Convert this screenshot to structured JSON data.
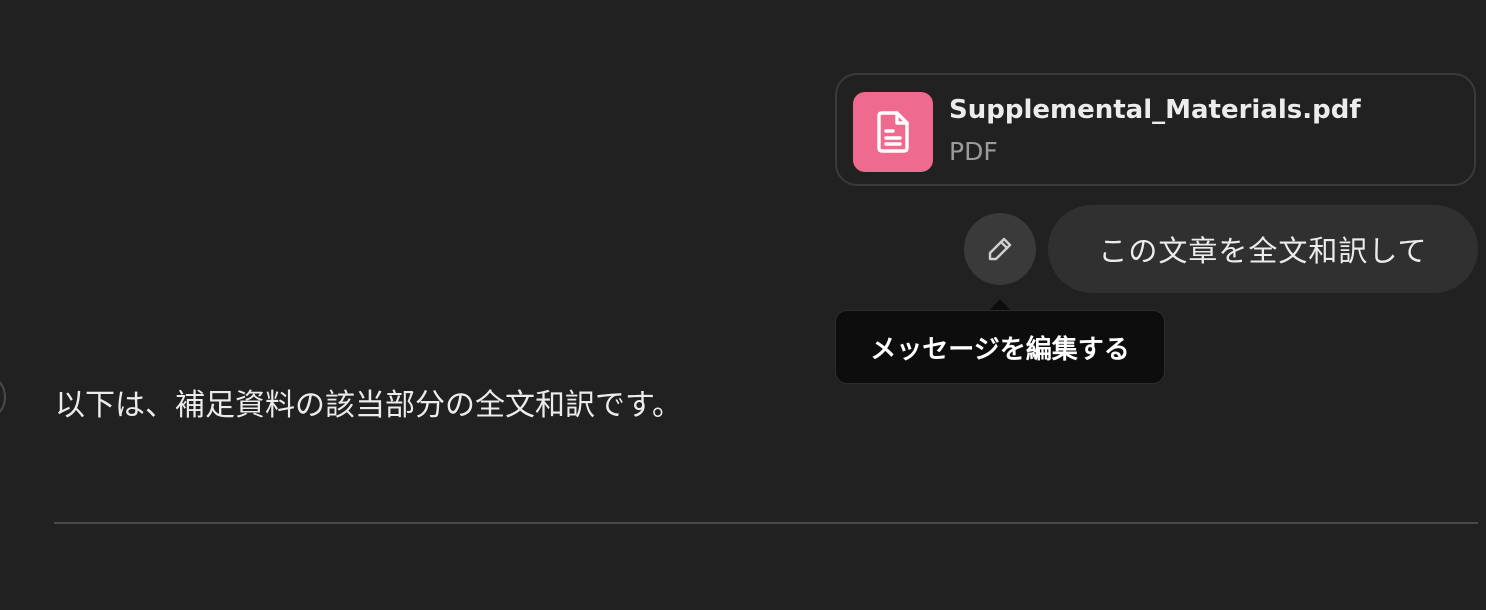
{
  "attachment": {
    "file_name": "Supplemental_Materials.pdf",
    "file_type": "PDF",
    "icon": "document-icon",
    "icon_color": "#ef6a8f"
  },
  "user_message": {
    "text": "この文章を全文和訳して",
    "edit_icon": "pencil-icon"
  },
  "tooltip": {
    "text": "メッセージを編集する"
  },
  "assistant_message": {
    "text": "以下は、補足資料の該当部分の全文和訳です。"
  },
  "colors": {
    "background": "#212121",
    "bubble": "#303030",
    "tooltip": "#0d0d0d"
  }
}
